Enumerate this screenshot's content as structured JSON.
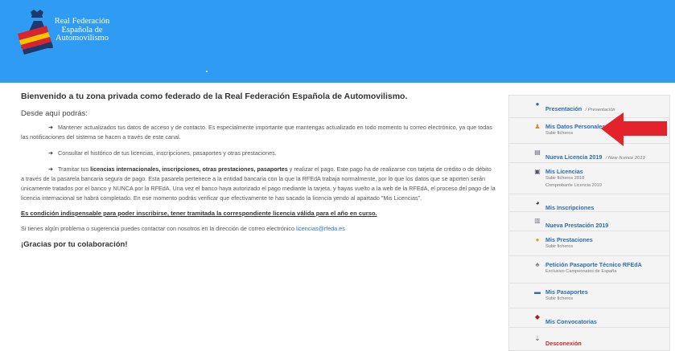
{
  "header": {
    "logo_lines": [
      "Real Federación",
      "Española de",
      "Automovilismo"
    ]
  },
  "main": {
    "title": "Bienvenido a tu zona privada como federado de la Real Federación Española de Automovilismo.",
    "lead": "Desde aquí podrás:",
    "p1": "Mantener actualizados tus datos de acceso y de contacto. Es especialmente importante que mantengas actualizado en todo momento tu correo electrónico, ya que todas las notificaciones del sistema se hacen a través de este canal.",
    "p2": "Consultar el histórico de tus licencias, inscripciones, pasaportes y otras prestaciones.",
    "p3_pre": "Tramitar tus ",
    "p3_bold": "licencias internacionales, inscripciones, otras prestaciones, pasaportes",
    "p3_post": " y realizar el pago. Este pago ha de realizarse con tarjeta de crédito o de débito a través de la pasarela bancaria segura de pago. Esta pasarela pertenece a la entidad bancaria con la que la RFEdA trabaja normalmente, por lo que los datos que se aporten serán únicamente tratados por el banco y NUNCA por la RFEdA. Una vez el banco haya autorizado el pago mediante la tarjeta, y hayas vuelto a la web de la RFEdA, el proceso del pago de la licencia internacional se habrá completado. En ese momento podrás verificar que efectivamente te has sacado la licencia yendo al apartado \"Mis Licencias\".",
    "condition": "Es condición indispensable para poder inscribirse, tener tramitada la correspondiente licencia válida para el año en curso.",
    "contact_pre": "Si tienes algún problema o sugerencia puedes contactar con nosotros en la dirección de correo electrónico ",
    "contact_email": "licencias@rfeda.es",
    "thanks": "¡Gracias por tu colaboración!"
  },
  "sidebar": {
    "items": [
      {
        "label": "Presentación",
        "tag": "/ Presentación",
        "icon": "info-icon"
      },
      {
        "label": "Mis Datos Personales",
        "sub": "Subir ficheros",
        "icon": "user-icon"
      },
      {
        "label": "Nueva Licencia 2019",
        "tag": "/ New licence 2019",
        "icon": "card-icon"
      },
      {
        "label": "Mis Licencias",
        "sub": "Subir ficheros 2018",
        "sub2": "Comprobante Licencia 2019",
        "icon": "license-icon"
      },
      {
        "label": "Mis Inscripciones",
        "icon": "helmet-icon"
      },
      {
        "label": "Nueva Prestación 2019",
        "icon": "list-icon"
      },
      {
        "label": "Mis Prestaciones",
        "sub": "Subir ficheros",
        "icon": "coin-icon"
      },
      {
        "label": "Petición Pasaporte Técnico RFEdA",
        "sub": "Exclusivo Campeonatos de España",
        "icon": "passport-icon"
      },
      {
        "label": "Mis Pasaportes",
        "sub": "Subir ficheros",
        "icon": "car-icon"
      },
      {
        "label": "Mis Convocatorias",
        "icon": "calendar-icon"
      },
      {
        "label": "Desconexión",
        "icon": "logout-icon"
      }
    ]
  },
  "colors": {
    "header": "#2f9bf2",
    "link": "#2a6db5",
    "logout": "#c8282b",
    "arrow": "#e4222b"
  }
}
